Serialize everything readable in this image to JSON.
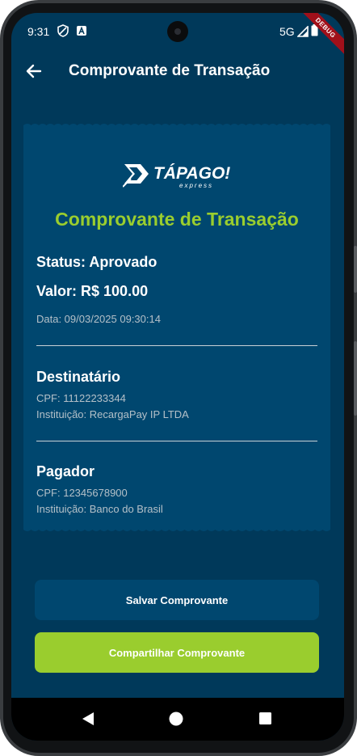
{
  "status_bar": {
    "time": "9:31",
    "network": "5G",
    "debug_banner": "DEBUG"
  },
  "app_bar": {
    "title": "Comprovante de Transação"
  },
  "receipt": {
    "logo": {
      "brand": "TÁPAGO!",
      "tagline": "express"
    },
    "heading": "Comprovante de Transação",
    "status": "Status: Aprovado",
    "amount": "Valor: R$ 100.00",
    "date": "Data: 09/03/2025 09:30:14",
    "recipient": {
      "title": "Destinatário",
      "cpf": "CPF: 11122233344",
      "institution": "Instituição: RecargaPay IP LTDA"
    },
    "payer": {
      "title": "Pagador",
      "cpf": "CPF: 12345678900",
      "institution": "Instituição: Banco do Brasil"
    }
  },
  "actions": {
    "save_label": "Salvar Comprovante",
    "share_label": "Compartilhar Comprovante"
  },
  "colors": {
    "background": "#00395a",
    "card": "#00476f",
    "accent": "#9acd2e",
    "text_secondary": "#b4c0c8"
  },
  "icons": {
    "back": "arrow-left-icon",
    "nav_back": "triangle-back-icon",
    "nav_home": "circle-home-icon",
    "nav_recents": "square-recents-icon"
  }
}
